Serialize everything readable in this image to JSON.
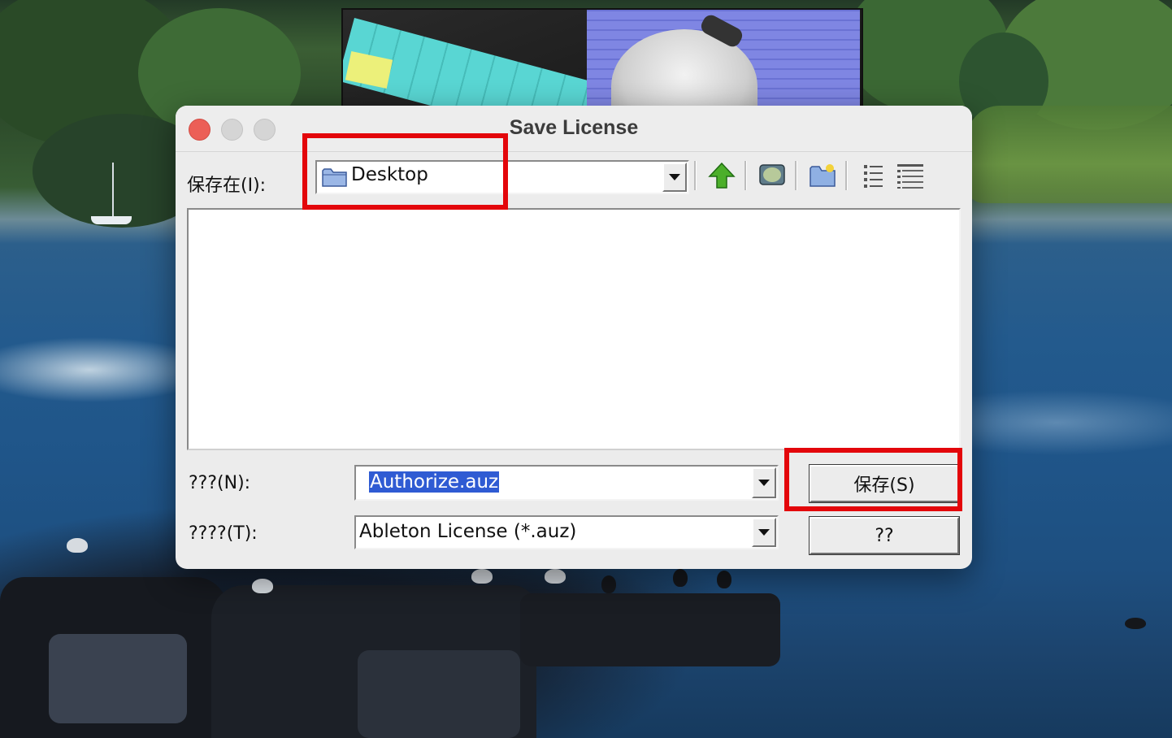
{
  "dialog": {
    "title": "Save License",
    "save_in_label": "保存在(I):",
    "save_in_value": "Desktop",
    "filename_label": "???(N):",
    "filename_value": "Authorize.auz",
    "filetype_label": "????(T):",
    "filetype_value": "Ableton License (*.auz)",
    "save_button": "保存(S)",
    "cancel_button": "??"
  },
  "toolbar": {
    "icons": [
      "up-one-level-icon",
      "desktop-icon",
      "new-folder-icon",
      "list-view-icon",
      "details-view-icon"
    ]
  },
  "colors": {
    "highlight": "#e3060b",
    "close": "#ec5f57",
    "selection": "#2f5bd3",
    "up_arrow": "#4caf2a"
  }
}
